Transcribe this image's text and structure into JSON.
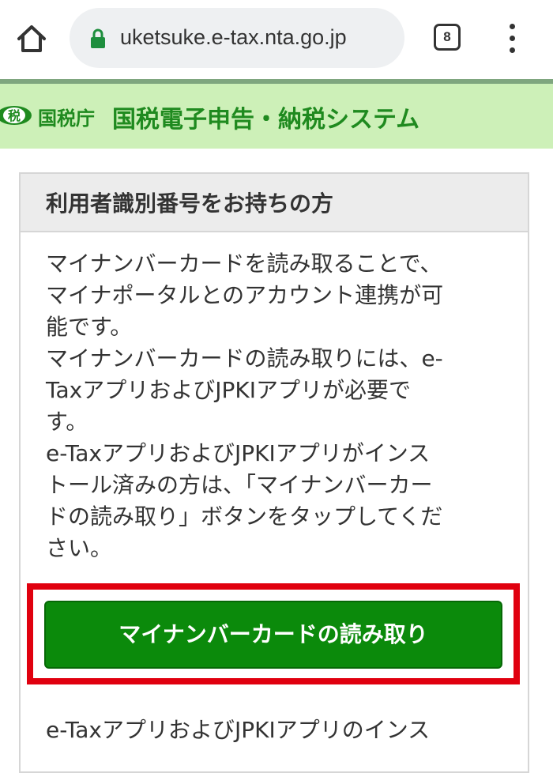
{
  "browser": {
    "url": "uketsuke.e-tax.nta.go.jp",
    "tab_count": "8"
  },
  "site_header": {
    "agency_name": "国税庁",
    "system_title": "国税電子申告・納税システム",
    "logo_text": "税"
  },
  "card": {
    "title": "利用者識別番号をお持ちの方",
    "description_lines": [
      "マイナンバーカードを読み取ることで、",
      "マイナポータルとのアカウント連携が可",
      "能です。",
      "マイナンバーカードの読み取りには、e-",
      "TaxアプリおよびJPKIアプリが必要で",
      "す。",
      "e-TaxアプリおよびJPKIアプリがインス",
      "トール済みの方は、「マイナンバーカー",
      "ドの読み取り」ボタンをタップしてくだ",
      "さい。"
    ],
    "read_button_label": "マイナンバーカードの読み取り",
    "footer_text": "e-TaxアプリおよびJPKIアプリのインス"
  },
  "colors": {
    "header_band": "#cdf0b8",
    "brand_green": "#1f8a1f",
    "button_green": "#0b8a0b",
    "highlight_red": "#e0000f"
  },
  "icons": [
    "home-icon",
    "lock-icon",
    "tab-count-icon",
    "more-menu-icon",
    "nta-logo-icon"
  ]
}
